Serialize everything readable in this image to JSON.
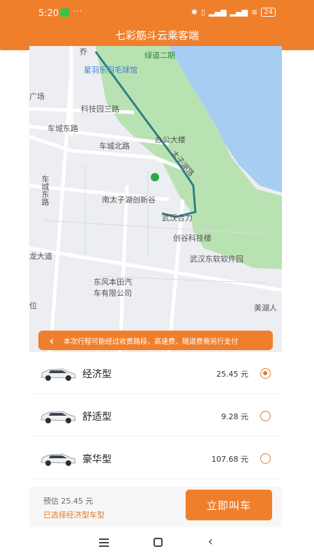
{
  "status_bar": {
    "time": "5:20",
    "dots": "···",
    "icons": [
      "bluetooth-icon",
      "signal-icon",
      "signal-icon",
      "wifi-icon"
    ],
    "battery": "24"
  },
  "header": {
    "title": "七彩筋斗云乘客端"
  },
  "map": {
    "labels": {
      "qiaoyu": "乔",
      "greenland": "绿道二期",
      "badminton": "星羽乐羽毛球馆",
      "square": "广场",
      "keji3": "科技园三路",
      "metro": "车城东路",
      "office": "办公大楼",
      "chechengbei": "车城北路",
      "taizihu": "太子湖路",
      "chechengdong": "车城东路",
      "nantaizihu": "南太子湖创新谷",
      "wuhanhe": "武汉合力",
      "chuanggu": "创谷科技楼",
      "longdadao": "龙大道",
      "neusoft": "武汉东软软件园",
      "dongfeng1": "东风本田汽",
      "dongfeng2": "车有限公司",
      "meihu": "美湖人",
      "wei": "位"
    },
    "colors": {
      "water": "#a8cdf3",
      "park": "#b9e2b2",
      "route": "#2f7f84"
    }
  },
  "notice": {
    "text": "本次行程可能经过收费路段，高速费、隧道费需另行支付"
  },
  "car_options": [
    {
      "name": "经济型",
      "price": "25.45 元",
      "selected": true
    },
    {
      "name": "舒适型",
      "price": "9.28 元",
      "selected": false
    },
    {
      "name": "豪华型",
      "price": "107.68 元",
      "selected": false
    }
  ],
  "bottom": {
    "estimate": "预估 25.45 元",
    "selected_type": "已选择经济型车型",
    "call_button": "立即叫车"
  },
  "theme": {
    "accent": "#f07f2c"
  }
}
